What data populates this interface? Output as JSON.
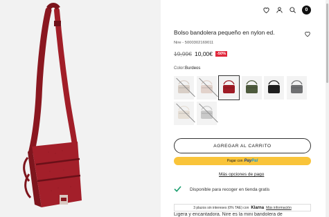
{
  "gallery": {
    "image": "red-nylon-crossbody-bag"
  },
  "header": {
    "icons": [
      "heart-icon",
      "user-icon",
      "search-icon",
      "bag-icon"
    ],
    "cart_count": "0"
  },
  "product": {
    "title": "Bolso bandolera pequeño en nylon ed.",
    "sku": "Nire - 5000302169011",
    "old_price": "19,99€",
    "new_price": "10,00€",
    "discount": "-50%",
    "color_label": "Color:",
    "color_value": "Burdeos"
  },
  "swatches": [
    {
      "name": "Beige claro",
      "color": "#d9cfc7",
      "sold_out": true,
      "selected": false
    },
    {
      "name": "Rosa palo",
      "color": "#e2d2cb",
      "sold_out": true,
      "selected": false
    },
    {
      "name": "Burdeos",
      "color": "#9e1b25",
      "sold_out": false,
      "selected": true
    },
    {
      "name": "Verde",
      "color": "#4d5a3c",
      "sold_out": false,
      "selected": false
    },
    {
      "name": "Negro",
      "color": "#1f1f1f",
      "sold_out": false,
      "selected": false
    },
    {
      "name": "Gris",
      "color": "#6f7072",
      "sold_out": false,
      "selected": false
    },
    {
      "name": "Crudo",
      "color": "#e6dfd6",
      "sold_out": true,
      "selected": false
    },
    {
      "name": "Gris claro",
      "color": "#c9c9c9",
      "sold_out": true,
      "selected": false
    }
  ],
  "actions": {
    "add_to_cart": "AGREGAR AL CARRITO",
    "paypal_prefix": "Pagar con",
    "paypal_brand_a": "Pay",
    "paypal_brand_b": "Pal",
    "more_options": "Más opciones de pago"
  },
  "pickup": {
    "text": "Disponible para recoger en tienda gratis",
    "icon": "check-icon"
  },
  "klarna": {
    "text": "3 plazos sin intereses (0% TAE) con",
    "brand": "Klarna",
    "link": "Más información"
  },
  "description": {
    "text": "Ligera y encantadora. Nire es la mini bandolera de"
  },
  "colors": {
    "accent": "#e0263a",
    "paypal": "#f9c43a",
    "check": "#1a9e6e",
    "bag": "#9e1b25"
  }
}
